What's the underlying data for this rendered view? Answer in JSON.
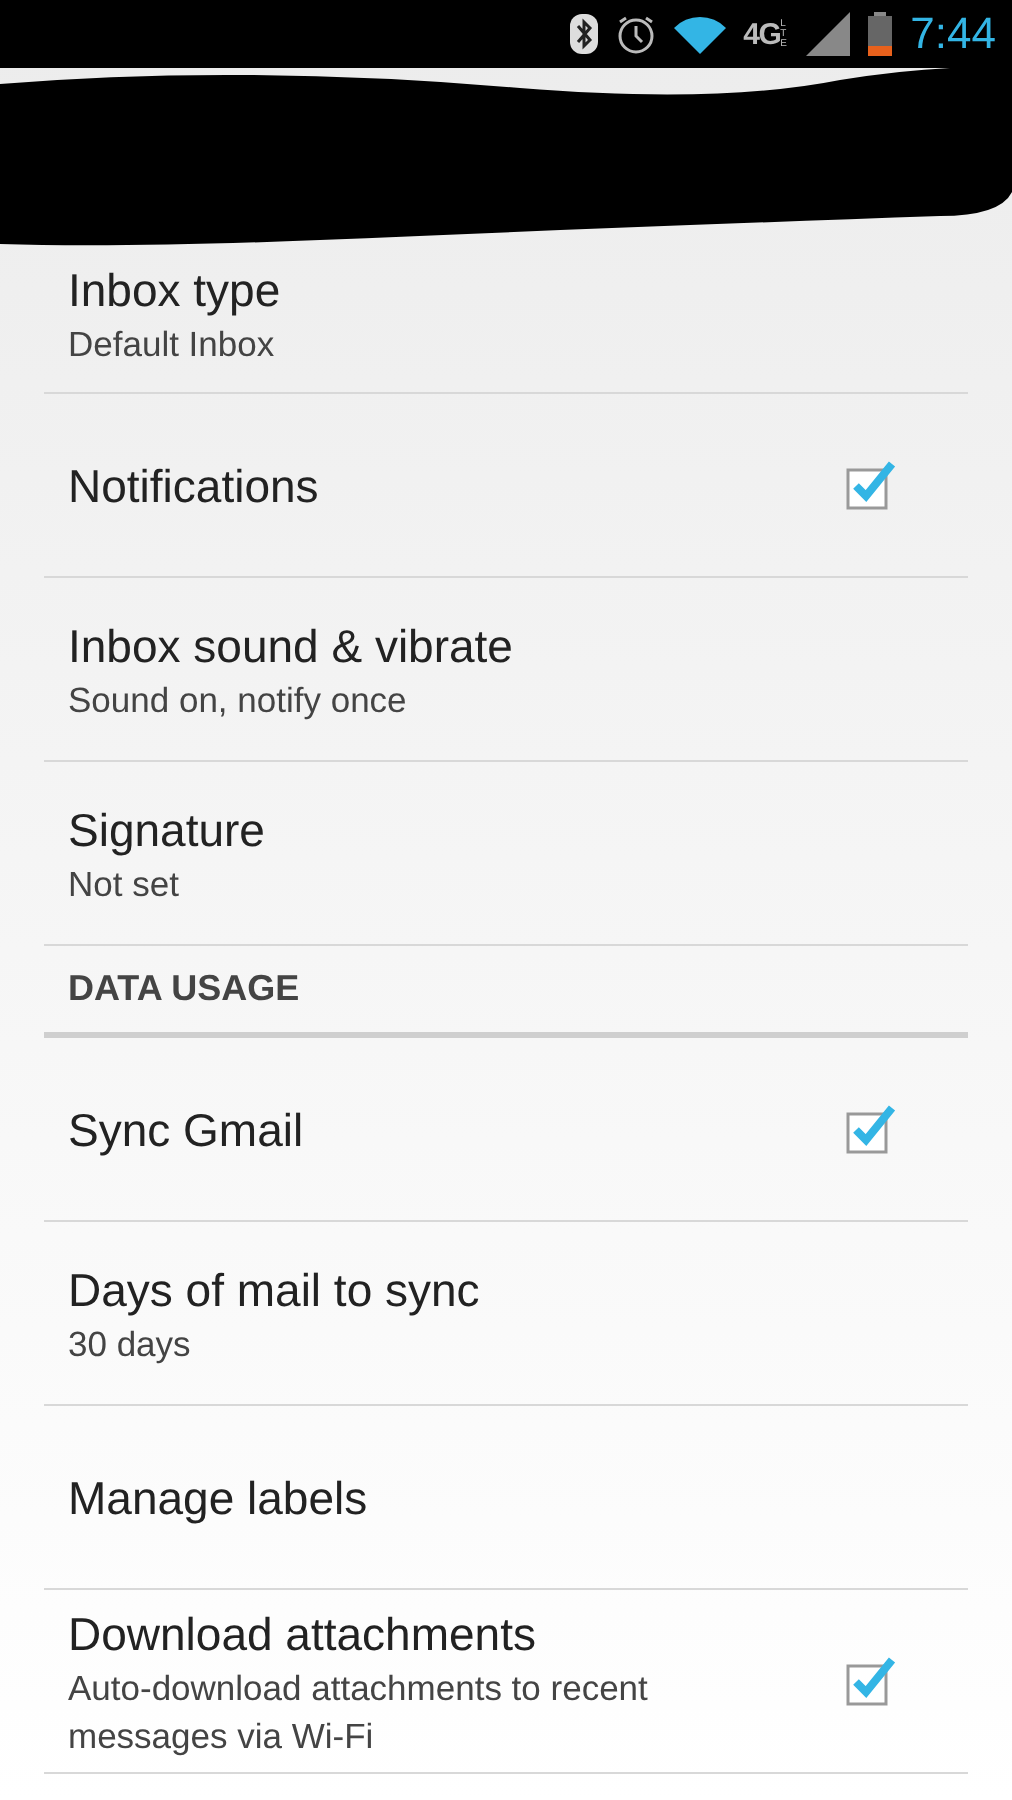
{
  "status_bar": {
    "network": "4G",
    "network_sub": "LTE",
    "time": "7:44"
  },
  "settings": [
    {
      "kind": "item",
      "title": "Inbox type",
      "summary": "Default Inbox"
    },
    {
      "kind": "checkbox",
      "title": "Notifications",
      "checked": true
    },
    {
      "kind": "item",
      "title": "Inbox sound & vibrate",
      "summary": "Sound on, notify once"
    },
    {
      "kind": "item",
      "title": "Signature",
      "summary": "Not set"
    },
    {
      "kind": "header",
      "title": "DATA USAGE"
    },
    {
      "kind": "checkbox",
      "title": "Sync Gmail",
      "checked": true
    },
    {
      "kind": "item",
      "title": "Days of mail to sync",
      "summary": "30 days"
    },
    {
      "kind": "item",
      "title": "Manage labels"
    },
    {
      "kind": "checkbox",
      "title": "Download attachments",
      "summary": "Auto-download attachments to recent messages via Wi-Fi",
      "checked": true
    }
  ]
}
